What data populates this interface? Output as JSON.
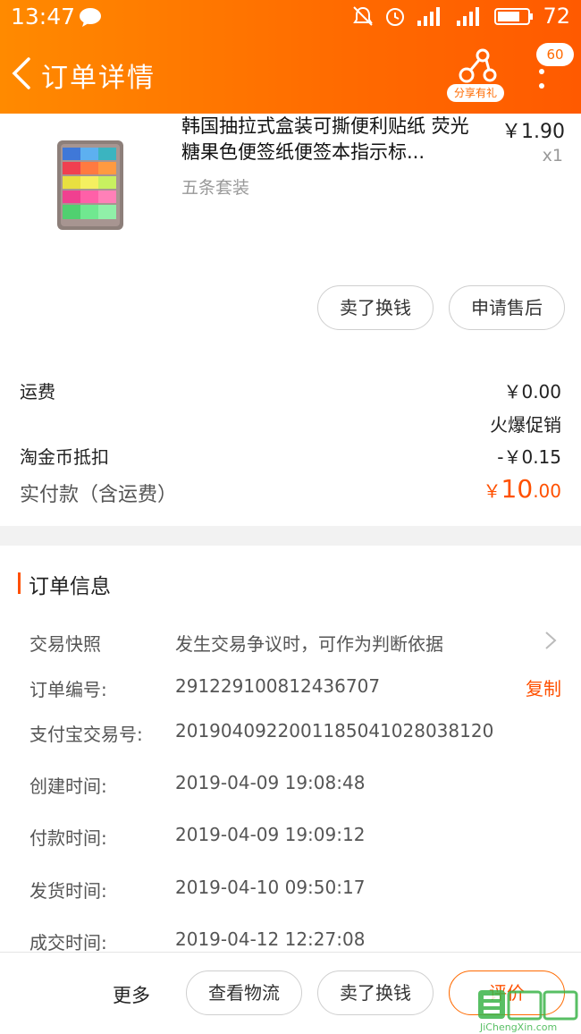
{
  "status_bar": {
    "time": "13:47",
    "battery": "72"
  },
  "header": {
    "title": "订单详情",
    "share_label": "分享有礼",
    "message_count": "60"
  },
  "product": {
    "title": "韩国抽拉式盒装可撕便利贴纸 荧光 糖果色便签纸便签本指示标...",
    "price": "￥1.90",
    "quantity": "x1",
    "sku": "五条套装"
  },
  "item_actions": {
    "sell": "卖了换钱",
    "after_sale": "申请售后"
  },
  "summary": {
    "shipping_label": "运费",
    "shipping_value": "￥0.00",
    "promo": "火爆促销",
    "coin_label": "淘金币抵扣",
    "coin_value": "-￥0.15",
    "paid_label": "实付款（含运费）",
    "paid_currency": "￥",
    "paid_int": "10",
    "paid_dec": ".00"
  },
  "order_info": {
    "title": "订单信息",
    "snapshot_label": "交易快照",
    "snapshot_value": "发生交易争议时，可作为判断依据",
    "order_no_label": "订单编号:",
    "order_no_value": "291229100812436707",
    "copy_label": "复制",
    "alipay_label": "支付宝交易号:",
    "alipay_value": "2019040922001185041028038120",
    "created_label": "创建时间:",
    "created_value": "2019-04-09 19:08:48",
    "paid_time_label": "付款时间:",
    "paid_time_value": "2019-04-09 19:09:12",
    "shipped_label": "发货时间:",
    "shipped_value": "2019-04-10 09:50:17",
    "completed_label": "成交时间:",
    "completed_value": "2019-04-12 12:27:08"
  },
  "bottom_bar": {
    "more": "更多",
    "logistics": "查看物流",
    "sell": "卖了换钱",
    "review": "评价"
  },
  "watermark": {
    "text": "JiChengXin.com"
  },
  "colors": {
    "brand_orange": "#ff6a00",
    "price_red": "#ff5000"
  }
}
